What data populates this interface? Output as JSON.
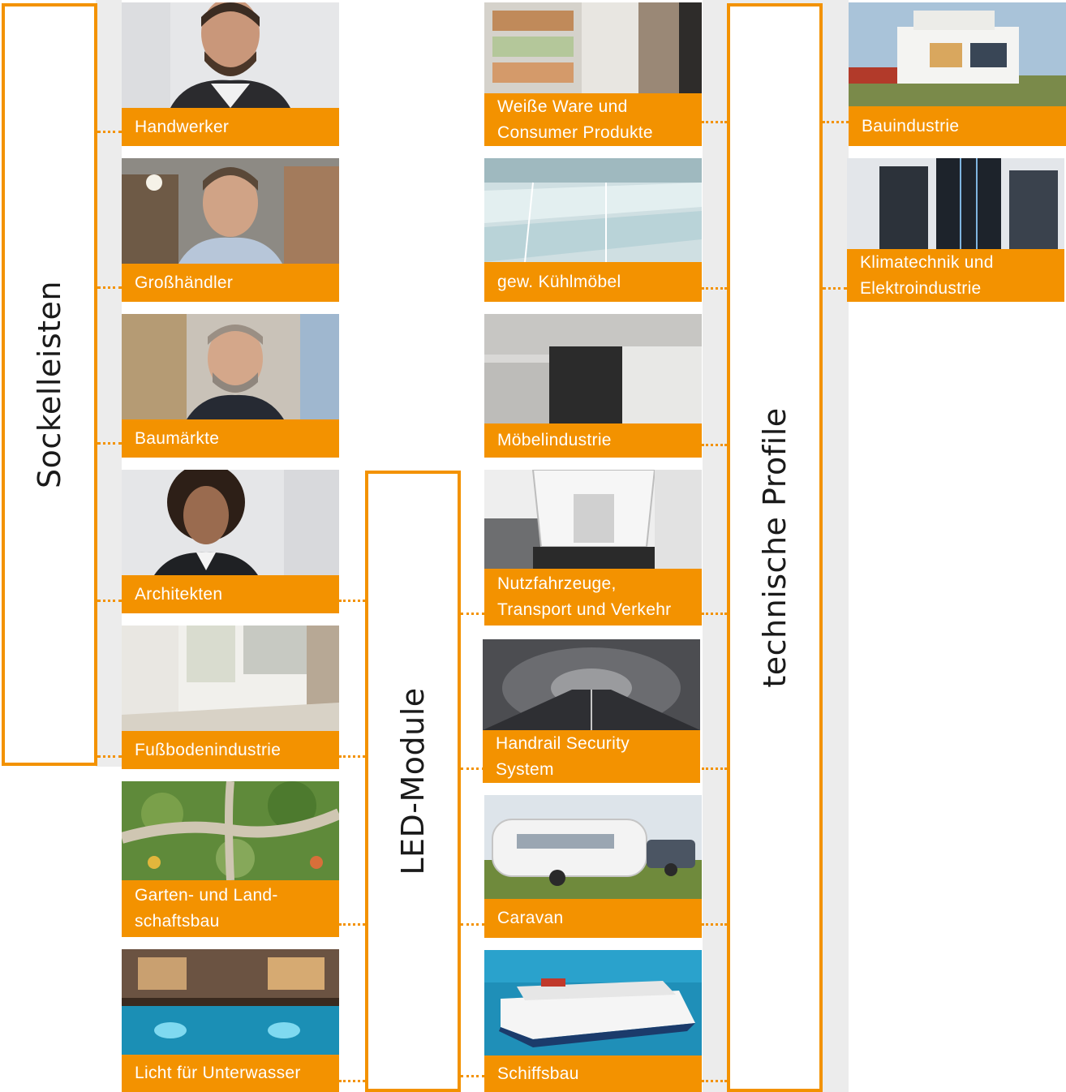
{
  "categories": {
    "sockelleisten": "Sockelleisten",
    "led_module": "LED-Module",
    "technische_profile": "technische Profile"
  },
  "sectors": {
    "handwerker": "Handwerker",
    "grosshaendler": "Großhändler",
    "baumaerkte": "Baumärkte",
    "architekten": "Architekten",
    "fussbodenindustrie": "Fußbodenindustrie",
    "garten_l1": "Garten- und Land-",
    "garten_l2": "schaftsbau",
    "unterwasser": "Licht für Unterwasser",
    "weisse_ware_l1": "Weiße Ware und",
    "weisse_ware_l2": "Consumer Produkte",
    "kuehlmoebel": "gew. Kühlmöbel",
    "moebelindustrie": "Möbelindustrie",
    "nutzfahrzeuge_l1": "Nutzfahrzeuge,",
    "nutzfahrzeuge_l2": "Transport und Verkehr",
    "handrail_l1": "Handrail Security",
    "handrail_l2": "System",
    "caravan": "Caravan",
    "schiffsbau": "Schiffsbau",
    "bauindustrie": "Bauindustrie",
    "klima_l1": "Klimatechnik und",
    "klima_l2": "Elektroindustrie"
  },
  "colors": {
    "accent": "#f39200",
    "track": "#ececec"
  }
}
